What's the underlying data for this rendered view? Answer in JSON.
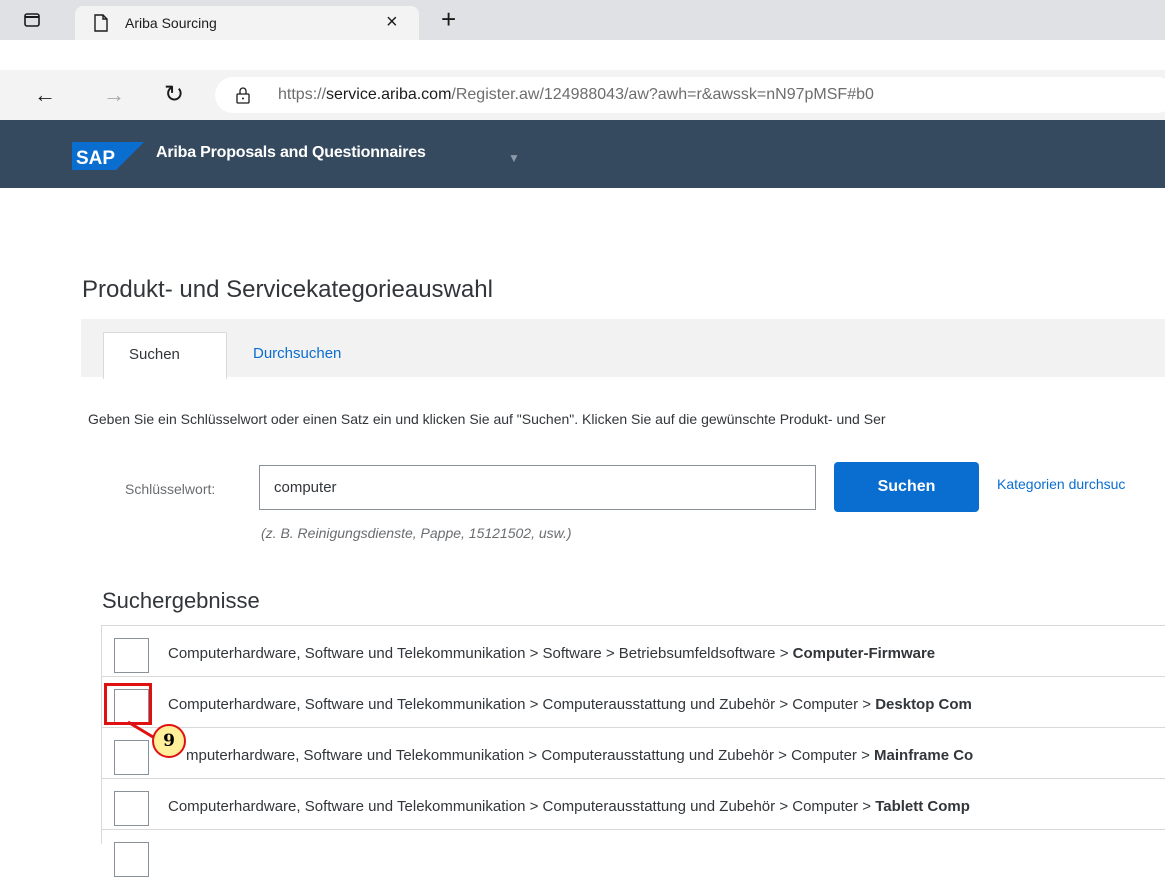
{
  "browser": {
    "tab_title": "Ariba Sourcing",
    "tab_close": "×",
    "new_tab": "+",
    "url_prefix": "https://",
    "url_host": "service.ariba.com",
    "url_path": "/Register.aw/124988043/aw?awh=r&awssk=nN97pMSF#b0"
  },
  "header": {
    "logo_text": "SAP",
    "app_title": "Ariba Proposals and Questionnaires",
    "accent_color": "#354a5f"
  },
  "page": {
    "title": "Produkt- und Servicekategorieauswahl",
    "tabs": [
      {
        "label": "Suchen",
        "active": true
      },
      {
        "label": "Durchsuchen",
        "active": false
      }
    ],
    "instructions": "Geben Sie ein Schlüsselwort oder einen Satz ein und klicken Sie auf \"Suchen\". Klicken Sie auf die gewünschte Produkt- und Ser"
  },
  "search": {
    "label": "Schlüsselwort:",
    "value": "computer",
    "hint": "(z. B. Reinigungsdienste, Pappe, 15121502, usw.)",
    "button_label": "Suchen",
    "browse_link": "Kategorien durchsuc"
  },
  "results": {
    "title": "Suchergebnisse",
    "rows": [
      {
        "path": "Computerhardware, Software und Telekommunikation > Software > Betriebsumfeldsoftware > ",
        "leaf": "Computer-Firmware"
      },
      {
        "path": "Computerhardware, Software und Telekommunikation > Computerausstattung und Zubehör > Computer > ",
        "leaf": "Desktop Com"
      },
      {
        "path": "mputerhardware, Software und Telekommunikation > Computerausstattung und Zubehör > Computer > ",
        "leaf": "Mainframe Co"
      },
      {
        "path": "Computerhardware, Software und Telekommunikation > Computerausstattung und Zubehör > Computer > ",
        "leaf": "Tablett Comp"
      }
    ]
  },
  "annotation": {
    "step_number": "9",
    "highlight_color": "#e01010"
  }
}
